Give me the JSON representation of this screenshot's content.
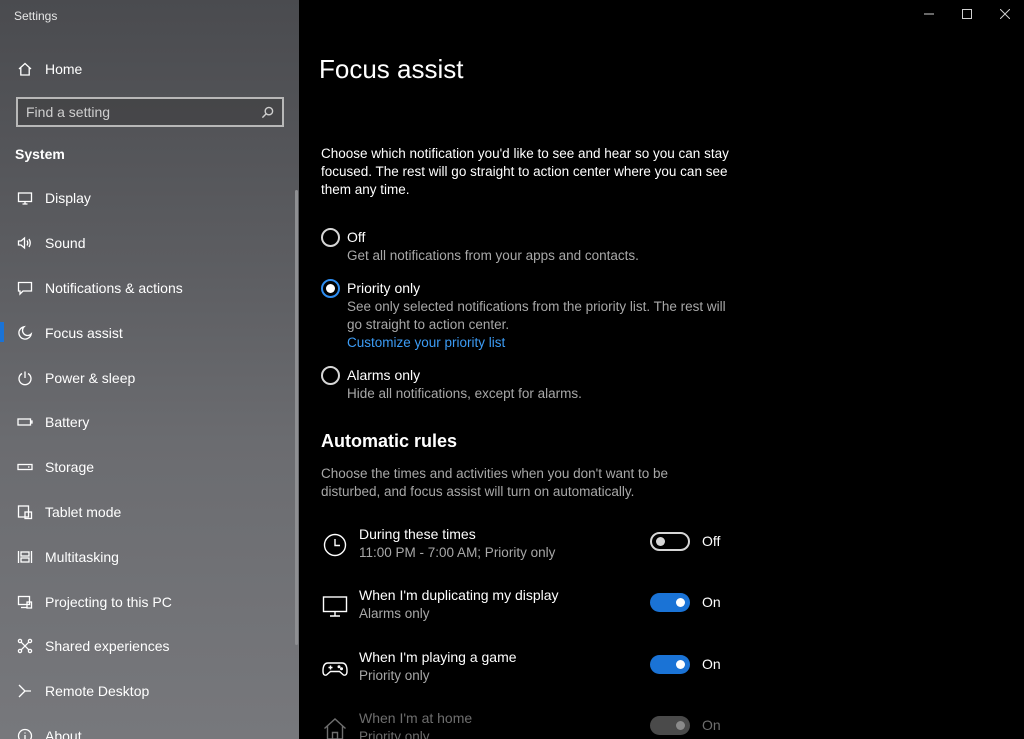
{
  "window": {
    "title": "Settings"
  },
  "sidebar": {
    "home_label": "Home",
    "search_placeholder": "Find a setting",
    "section_label": "System",
    "items": [
      {
        "label": "Display",
        "icon": "monitor-icon"
      },
      {
        "label": "Sound",
        "icon": "speaker-icon"
      },
      {
        "label": "Notifications & actions",
        "icon": "message-icon"
      },
      {
        "label": "Focus assist",
        "icon": "moon-icon",
        "active": true
      },
      {
        "label": "Power & sleep",
        "icon": "power-icon"
      },
      {
        "label": "Battery",
        "icon": "battery-icon"
      },
      {
        "label": "Storage",
        "icon": "storage-icon"
      },
      {
        "label": "Tablet mode",
        "icon": "tablet-icon"
      },
      {
        "label": "Multitasking",
        "icon": "multitasking-icon"
      },
      {
        "label": "Projecting to this PC",
        "icon": "projecting-icon"
      },
      {
        "label": "Shared experiences",
        "icon": "shared-icon"
      },
      {
        "label": "Remote Desktop",
        "icon": "remote-icon"
      },
      {
        "label": "About",
        "icon": "info-icon"
      }
    ]
  },
  "main": {
    "title": "Focus assist",
    "intro": "Choose which notification you'd like to see and hear so you can stay focused. The rest will go straight to action center where you can see them any time.",
    "options": [
      {
        "label": "Off",
        "desc": "Get all notifications from your apps and contacts.",
        "checked": false
      },
      {
        "label": "Priority only",
        "desc": "See only selected notifications from the priority list. The rest will go straight to action center.",
        "link": "Customize your priority list",
        "checked": true
      },
      {
        "label": "Alarms only",
        "desc": "Hide all notifications, except for alarms.",
        "checked": false
      }
    ],
    "rules_title": "Automatic rules",
    "rules_desc": "Choose the times and activities when you don't want to be disturbed, and focus assist will turn on automatically.",
    "rules": [
      {
        "title": "During these times",
        "subtitle": "11:00 PM - 7:00 AM; Priority only",
        "state": "Off",
        "on": false,
        "icon": "clock-icon"
      },
      {
        "title": "When I'm duplicating my display",
        "subtitle": "Alarms only",
        "state": "On",
        "on": true,
        "icon": "monitor-icon"
      },
      {
        "title": "When I'm playing a game",
        "subtitle": "Priority only",
        "state": "On",
        "on": true,
        "icon": "gamepad-icon"
      },
      {
        "title": "When I'm at home",
        "subtitle": "Priority only",
        "state": "On",
        "on": true,
        "icon": "home-icon",
        "disabled": true
      }
    ]
  },
  "colors": {
    "accent": "#1a73d6",
    "link": "#3c9cf5"
  }
}
